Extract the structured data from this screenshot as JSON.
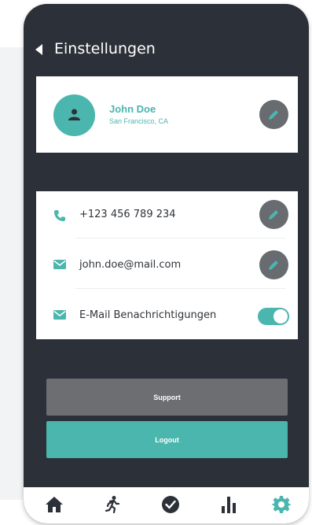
{
  "header": {
    "title": "Einstellungen"
  },
  "profile": {
    "name": "John Doe",
    "location": "San Francisco, CA"
  },
  "contacts": {
    "phone": "+123 456 789 234",
    "email": "john.doe@mail.com",
    "email_notifications_label": "E-Mail Benachrichtigungen",
    "email_notifications_enabled": true
  },
  "actions": {
    "support_label": "Support",
    "logout_label": "Logout"
  },
  "nav": {
    "items": [
      {
        "icon": "home-icon"
      },
      {
        "icon": "running-icon"
      },
      {
        "icon": "check-circle-icon"
      },
      {
        "icon": "bar-chart-icon"
      },
      {
        "icon": "gear-icon",
        "active": true
      }
    ]
  },
  "colors": {
    "accent": "#4ab6ae",
    "dark_bg": "#2c3038",
    "button_gray": "#6c6e71",
    "edit_button": "#686b70",
    "nav_icon": "#2c3038"
  }
}
